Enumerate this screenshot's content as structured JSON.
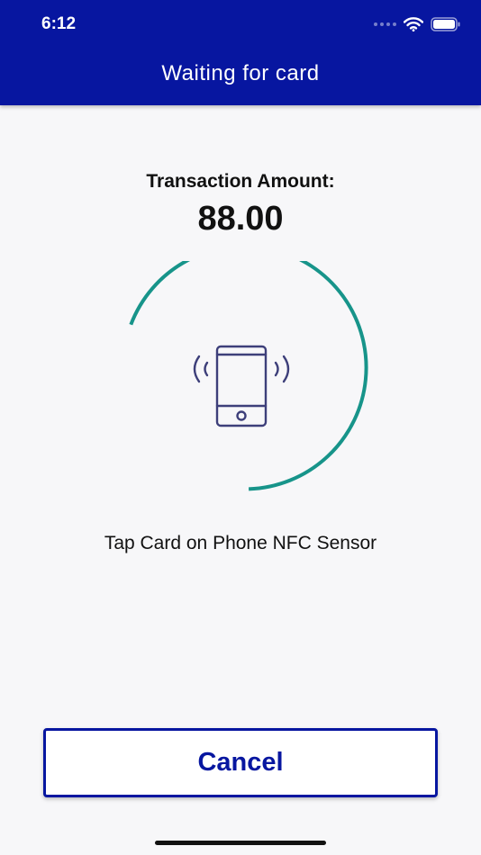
{
  "status_bar": {
    "time": "6:12",
    "icons": [
      "cellular-signal-icon",
      "wifi-icon",
      "battery-icon"
    ]
  },
  "header": {
    "title": "Waiting for card"
  },
  "transaction": {
    "label": "Transaction Amount:",
    "amount": "88.00"
  },
  "nfc": {
    "icon": "phone-nfc-icon",
    "progress_ring_color": "#17948a",
    "instruction": "Tap Card on Phone NFC Sensor"
  },
  "actions": {
    "cancel_label": "Cancel"
  },
  "colors": {
    "header_background": "#0716a0",
    "accent": "#0716a0",
    "icon_stroke": "#3d3f7a",
    "page_background": "#f7f7f9"
  }
}
